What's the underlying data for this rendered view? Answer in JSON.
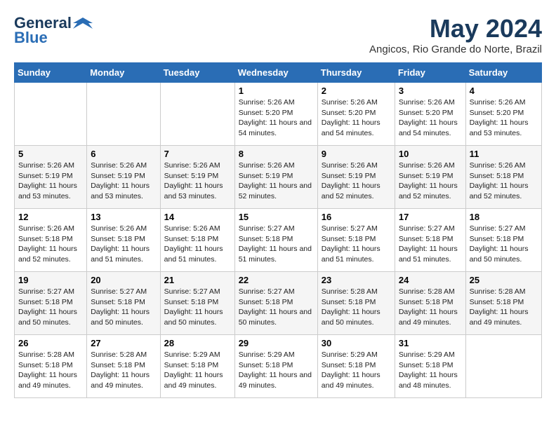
{
  "header": {
    "logo_line1": "General",
    "logo_line2": "Blue",
    "month_title": "May 2024",
    "location": "Angicos, Rio Grande do Norte, Brazil"
  },
  "weekdays": [
    "Sunday",
    "Monday",
    "Tuesday",
    "Wednesday",
    "Thursday",
    "Friday",
    "Saturday"
  ],
  "weeks": [
    [
      null,
      null,
      null,
      {
        "day": "1",
        "sunrise": "Sunrise: 5:26 AM",
        "sunset": "Sunset: 5:20 PM",
        "daylight": "Daylight: 11 hours and 54 minutes."
      },
      {
        "day": "2",
        "sunrise": "Sunrise: 5:26 AM",
        "sunset": "Sunset: 5:20 PM",
        "daylight": "Daylight: 11 hours and 54 minutes."
      },
      {
        "day": "3",
        "sunrise": "Sunrise: 5:26 AM",
        "sunset": "Sunset: 5:20 PM",
        "daylight": "Daylight: 11 hours and 54 minutes."
      },
      {
        "day": "4",
        "sunrise": "Sunrise: 5:26 AM",
        "sunset": "Sunset: 5:20 PM",
        "daylight": "Daylight: 11 hours and 53 minutes."
      }
    ],
    [
      {
        "day": "5",
        "sunrise": "Sunrise: 5:26 AM",
        "sunset": "Sunset: 5:19 PM",
        "daylight": "Daylight: 11 hours and 53 minutes."
      },
      {
        "day": "6",
        "sunrise": "Sunrise: 5:26 AM",
        "sunset": "Sunset: 5:19 PM",
        "daylight": "Daylight: 11 hours and 53 minutes."
      },
      {
        "day": "7",
        "sunrise": "Sunrise: 5:26 AM",
        "sunset": "Sunset: 5:19 PM",
        "daylight": "Daylight: 11 hours and 53 minutes."
      },
      {
        "day": "8",
        "sunrise": "Sunrise: 5:26 AM",
        "sunset": "Sunset: 5:19 PM",
        "daylight": "Daylight: 11 hours and 52 minutes."
      },
      {
        "day": "9",
        "sunrise": "Sunrise: 5:26 AM",
        "sunset": "Sunset: 5:19 PM",
        "daylight": "Daylight: 11 hours and 52 minutes."
      },
      {
        "day": "10",
        "sunrise": "Sunrise: 5:26 AM",
        "sunset": "Sunset: 5:19 PM",
        "daylight": "Daylight: 11 hours and 52 minutes."
      },
      {
        "day": "11",
        "sunrise": "Sunrise: 5:26 AM",
        "sunset": "Sunset: 5:18 PM",
        "daylight": "Daylight: 11 hours and 52 minutes."
      }
    ],
    [
      {
        "day": "12",
        "sunrise": "Sunrise: 5:26 AM",
        "sunset": "Sunset: 5:18 PM",
        "daylight": "Daylight: 11 hours and 52 minutes."
      },
      {
        "day": "13",
        "sunrise": "Sunrise: 5:26 AM",
        "sunset": "Sunset: 5:18 PM",
        "daylight": "Daylight: 11 hours and 51 minutes."
      },
      {
        "day": "14",
        "sunrise": "Sunrise: 5:26 AM",
        "sunset": "Sunset: 5:18 PM",
        "daylight": "Daylight: 11 hours and 51 minutes."
      },
      {
        "day": "15",
        "sunrise": "Sunrise: 5:27 AM",
        "sunset": "Sunset: 5:18 PM",
        "daylight": "Daylight: 11 hours and 51 minutes."
      },
      {
        "day": "16",
        "sunrise": "Sunrise: 5:27 AM",
        "sunset": "Sunset: 5:18 PM",
        "daylight": "Daylight: 11 hours and 51 minutes."
      },
      {
        "day": "17",
        "sunrise": "Sunrise: 5:27 AM",
        "sunset": "Sunset: 5:18 PM",
        "daylight": "Daylight: 11 hours and 51 minutes."
      },
      {
        "day": "18",
        "sunrise": "Sunrise: 5:27 AM",
        "sunset": "Sunset: 5:18 PM",
        "daylight": "Daylight: 11 hours and 50 minutes."
      }
    ],
    [
      {
        "day": "19",
        "sunrise": "Sunrise: 5:27 AM",
        "sunset": "Sunset: 5:18 PM",
        "daylight": "Daylight: 11 hours and 50 minutes."
      },
      {
        "day": "20",
        "sunrise": "Sunrise: 5:27 AM",
        "sunset": "Sunset: 5:18 PM",
        "daylight": "Daylight: 11 hours and 50 minutes."
      },
      {
        "day": "21",
        "sunrise": "Sunrise: 5:27 AM",
        "sunset": "Sunset: 5:18 PM",
        "daylight": "Daylight: 11 hours and 50 minutes."
      },
      {
        "day": "22",
        "sunrise": "Sunrise: 5:27 AM",
        "sunset": "Sunset: 5:18 PM",
        "daylight": "Daylight: 11 hours and 50 minutes."
      },
      {
        "day": "23",
        "sunrise": "Sunrise: 5:28 AM",
        "sunset": "Sunset: 5:18 PM",
        "daylight": "Daylight: 11 hours and 50 minutes."
      },
      {
        "day": "24",
        "sunrise": "Sunrise: 5:28 AM",
        "sunset": "Sunset: 5:18 PM",
        "daylight": "Daylight: 11 hours and 49 minutes."
      },
      {
        "day": "25",
        "sunrise": "Sunrise: 5:28 AM",
        "sunset": "Sunset: 5:18 PM",
        "daylight": "Daylight: 11 hours and 49 minutes."
      }
    ],
    [
      {
        "day": "26",
        "sunrise": "Sunrise: 5:28 AM",
        "sunset": "Sunset: 5:18 PM",
        "daylight": "Daylight: 11 hours and 49 minutes."
      },
      {
        "day": "27",
        "sunrise": "Sunrise: 5:28 AM",
        "sunset": "Sunset: 5:18 PM",
        "daylight": "Daylight: 11 hours and 49 minutes."
      },
      {
        "day": "28",
        "sunrise": "Sunrise: 5:29 AM",
        "sunset": "Sunset: 5:18 PM",
        "daylight": "Daylight: 11 hours and 49 minutes."
      },
      {
        "day": "29",
        "sunrise": "Sunrise: 5:29 AM",
        "sunset": "Sunset: 5:18 PM",
        "daylight": "Daylight: 11 hours and 49 minutes."
      },
      {
        "day": "30",
        "sunrise": "Sunrise: 5:29 AM",
        "sunset": "Sunset: 5:18 PM",
        "daylight": "Daylight: 11 hours and 49 minutes."
      },
      {
        "day": "31",
        "sunrise": "Sunrise: 5:29 AM",
        "sunset": "Sunset: 5:18 PM",
        "daylight": "Daylight: 11 hours and 48 minutes."
      },
      null
    ]
  ]
}
